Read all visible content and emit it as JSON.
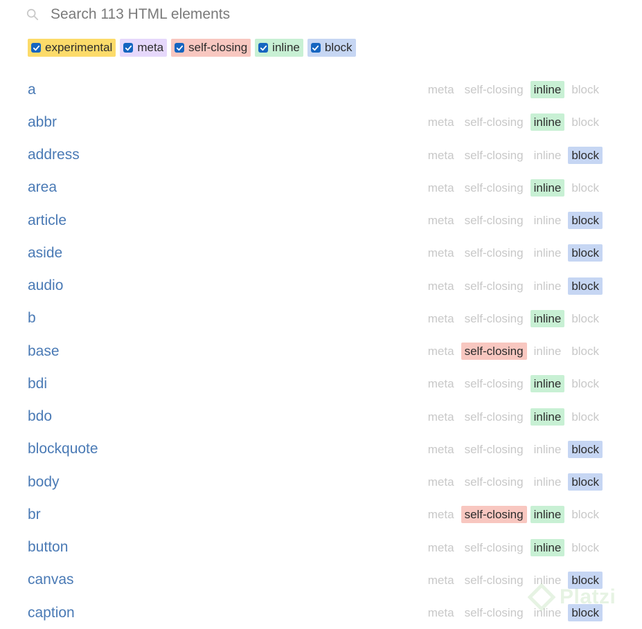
{
  "search": {
    "placeholder": "Search 113 HTML elements",
    "value": ""
  },
  "filters": [
    {
      "label": "experimental",
      "checked": true,
      "color": "#fcdb6a"
    },
    {
      "label": "meta",
      "checked": true,
      "color": "#e6d8fb"
    },
    {
      "label": "self-closing",
      "checked": true,
      "color": "#f8c7c0"
    },
    {
      "label": "inline",
      "checked": true,
      "color": "#c8f0d4"
    },
    {
      "label": "block",
      "checked": true,
      "color": "#c6d6f3"
    }
  ],
  "tag_labels": {
    "meta": "meta",
    "self_closing": "self-closing",
    "inline": "inline",
    "block": "block"
  },
  "elements": [
    {
      "name": "a",
      "meta": false,
      "self_closing": false,
      "inline": true,
      "block": false
    },
    {
      "name": "abbr",
      "meta": false,
      "self_closing": false,
      "inline": true,
      "block": false
    },
    {
      "name": "address",
      "meta": false,
      "self_closing": false,
      "inline": false,
      "block": true
    },
    {
      "name": "area",
      "meta": false,
      "self_closing": false,
      "inline": true,
      "block": false
    },
    {
      "name": "article",
      "meta": false,
      "self_closing": false,
      "inline": false,
      "block": true
    },
    {
      "name": "aside",
      "meta": false,
      "self_closing": false,
      "inline": false,
      "block": true
    },
    {
      "name": "audio",
      "meta": false,
      "self_closing": false,
      "inline": false,
      "block": true
    },
    {
      "name": "b",
      "meta": false,
      "self_closing": false,
      "inline": true,
      "block": false
    },
    {
      "name": "base",
      "meta": false,
      "self_closing": true,
      "inline": false,
      "block": false
    },
    {
      "name": "bdi",
      "meta": false,
      "self_closing": false,
      "inline": true,
      "block": false
    },
    {
      "name": "bdo",
      "meta": false,
      "self_closing": false,
      "inline": true,
      "block": false
    },
    {
      "name": "blockquote",
      "meta": false,
      "self_closing": false,
      "inline": false,
      "block": true
    },
    {
      "name": "body",
      "meta": false,
      "self_closing": false,
      "inline": false,
      "block": true
    },
    {
      "name": "br",
      "meta": false,
      "self_closing": true,
      "inline": true,
      "block": false
    },
    {
      "name": "button",
      "meta": false,
      "self_closing": false,
      "inline": true,
      "block": false
    },
    {
      "name": "canvas",
      "meta": false,
      "self_closing": false,
      "inline": false,
      "block": true
    },
    {
      "name": "caption",
      "meta": false,
      "self_closing": false,
      "inline": false,
      "block": true
    }
  ],
  "watermark": {
    "text": "Platzi"
  }
}
